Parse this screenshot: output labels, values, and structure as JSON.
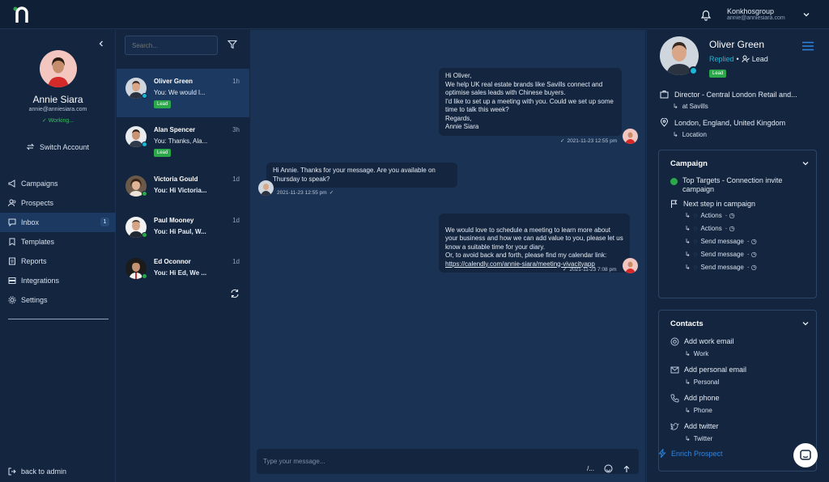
{
  "header": {
    "account_name": "Konkhosgroup",
    "account_email": "annie@anniesiara.com"
  },
  "sidebar": {
    "user_name": "Annie Siara",
    "user_email": "annie@anniesiara.com",
    "user_status": "Working...",
    "switch_account": "Switch Account",
    "items": [
      {
        "label": "Campaigns",
        "icon": "megaphone-icon"
      },
      {
        "label": "Prospects",
        "icon": "users-icon"
      },
      {
        "label": "Inbox",
        "icon": "chat-icon",
        "badge": "1",
        "active": true
      },
      {
        "label": "Templates",
        "icon": "bookmark-icon"
      },
      {
        "label": "Reports",
        "icon": "report-icon"
      },
      {
        "label": "Integrations",
        "icon": "layers-icon"
      },
      {
        "label": "Settings",
        "icon": "gear-icon"
      }
    ],
    "back_admin": "back to admin"
  },
  "conversations": {
    "search_placeholder": "Search...",
    "items": [
      {
        "name": "Oliver Green",
        "time": "1h",
        "preview": "You: We would l...",
        "tag": "Lead",
        "bold": false
      },
      {
        "name": "Alan Spencer",
        "time": "3h",
        "preview": "You: Thanks, Ala...",
        "tag": "Lead",
        "bold": false
      },
      {
        "name": "Victoria Gould",
        "time": "1d",
        "preview": "You: Hi Victoria...",
        "tag": "",
        "bold": true
      },
      {
        "name": "Paul Mooney",
        "time": "1d",
        "preview": "You: Hi Paul, W...",
        "tag": "",
        "bold": true
      },
      {
        "name": "Ed Oconnor",
        "time": "1d",
        "preview": "You: Hi Ed, We ...",
        "tag": "",
        "bold": true
      }
    ]
  },
  "chat": {
    "messages": [
      {
        "text": "Hi Oliver,\nWe help UK real estate brands like Savills connect and optimise sales leads with Chinese buyers.\nI'd like to set up a meeting with you. Could we set up some time to talk this week?\nRegards,\nAnnie Siara",
        "time": "2021-11-23 12:55 pm"
      },
      {
        "text": "Hi Annie. Thanks for your message. Are you available on Thursday to speak?",
        "time": "2021-11-23 12:55 pm"
      },
      {
        "text": "We would love to schedule a meeting to learn more about your business and how we can add value to you, please let us know a suitable time for your diary.\nOr, to avoid back and forth, please find my calendar link:",
        "link": "https://calendly.com/annie-siara/meeting-vivacityapp",
        "time": "2021-11-23 7:08 pm"
      }
    ],
    "input_placeholder": "Type your message...",
    "slash_label": "/..."
  },
  "prospect": {
    "name": "Oliver Green",
    "status": "Replied",
    "role": "Lead",
    "tag": "Lead",
    "title": "Director - Central London Retail and...",
    "company": "at Savills",
    "location": "London, England, United Kingdom",
    "location_label": "Location"
  },
  "campaign": {
    "title": "Campaign",
    "name": "Top Targets - Connection invite campaign",
    "next_step": "Next step in campaign",
    "steps": [
      "Actions",
      "Actions",
      "Send message",
      "Send message",
      "Send message"
    ]
  },
  "contacts": {
    "title": "Contacts",
    "items": [
      {
        "label": "Add work email",
        "sub": "Work",
        "icon": "at-icon"
      },
      {
        "label": "Add personal email",
        "sub": "Personal",
        "icon": "mail-icon"
      },
      {
        "label": "Add phone",
        "sub": "Phone",
        "icon": "phone-icon"
      },
      {
        "label": "Add twitter",
        "sub": "Twitter",
        "icon": "twitter-icon"
      }
    ],
    "enrich": "Enrich Prospect"
  },
  "colors": {
    "accent": "#1ab8d6",
    "lead_green": "#2aa84a",
    "link_blue": "#2f86e0",
    "bg_dark": "#13253f",
    "chat_bg": "#1a3254"
  }
}
